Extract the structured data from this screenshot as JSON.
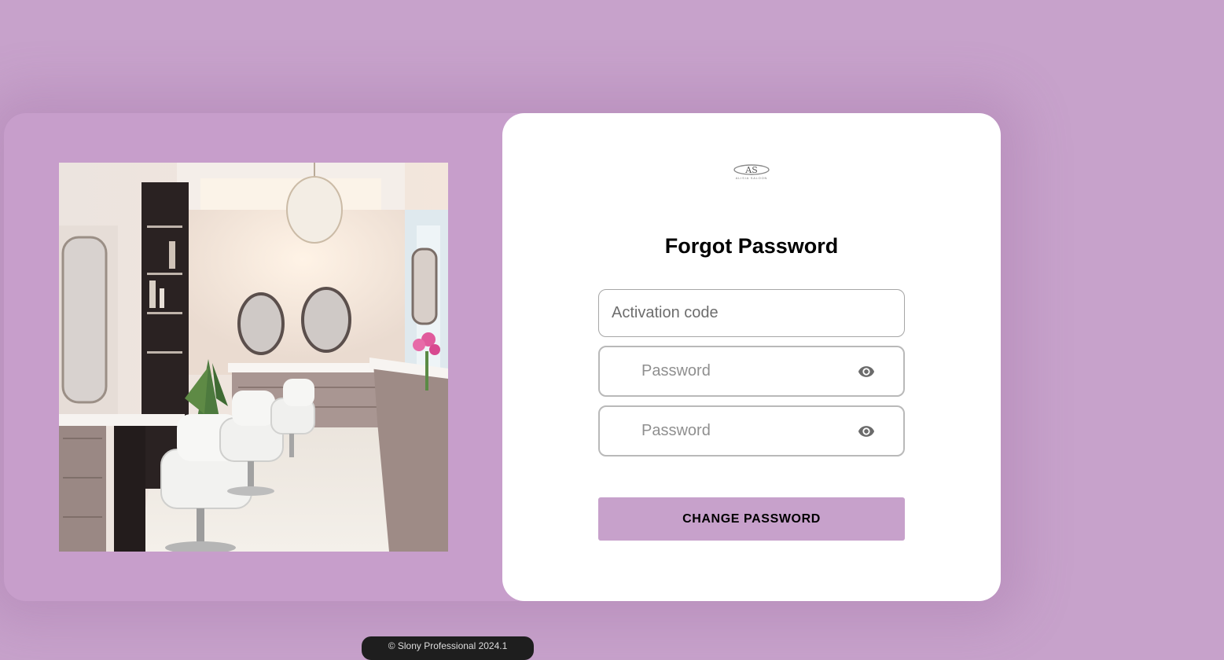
{
  "logo": {
    "text": "AS",
    "subtext": "ALISIA SALOON"
  },
  "form": {
    "title": "Forgot Password",
    "activation_placeholder": "Activation code",
    "password_placeholder": "Password",
    "confirm_password_placeholder": "Password",
    "submit_label": "CHANGE PASSWORD"
  },
  "footer": {
    "version_text": "© Slony Professional 2024.1"
  },
  "icons": {
    "password_toggle": "eye-icon"
  },
  "colors": {
    "background": "#c7a2cb",
    "card": "#c79ecb",
    "button": "#c7a1cb",
    "panel": "#ffffff"
  }
}
